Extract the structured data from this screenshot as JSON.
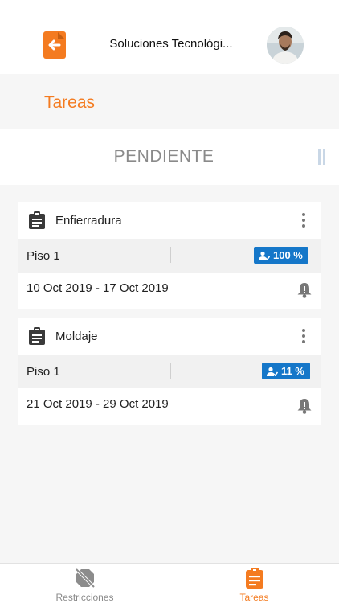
{
  "header": {
    "company_name": "Soluciones Tecnológi...",
    "back_icon": "exit-back-icon",
    "avatar_icon": "user-avatar"
  },
  "section": {
    "title": "Tareas"
  },
  "status": {
    "title": "PENDIENTE"
  },
  "tasks": [
    {
      "name": "Enfierradura",
      "floor": "Piso 1",
      "progress_label": "100 %",
      "progress_value": 100,
      "dates": "10 Oct 2019 - 17 Oct 2019"
    },
    {
      "name": "Moldaje",
      "floor": "Piso 1",
      "progress_label": "11 %",
      "progress_value": 11,
      "dates": "21 Oct 2019 - 29 Oct 2019"
    }
  ],
  "tabbar": {
    "restrictions_label": "Restricciones",
    "tasks_label": "Tareas"
  },
  "colors": {
    "accent": "#f47b20",
    "badge": "#1577c9",
    "inactive": "#8a8a8a"
  }
}
